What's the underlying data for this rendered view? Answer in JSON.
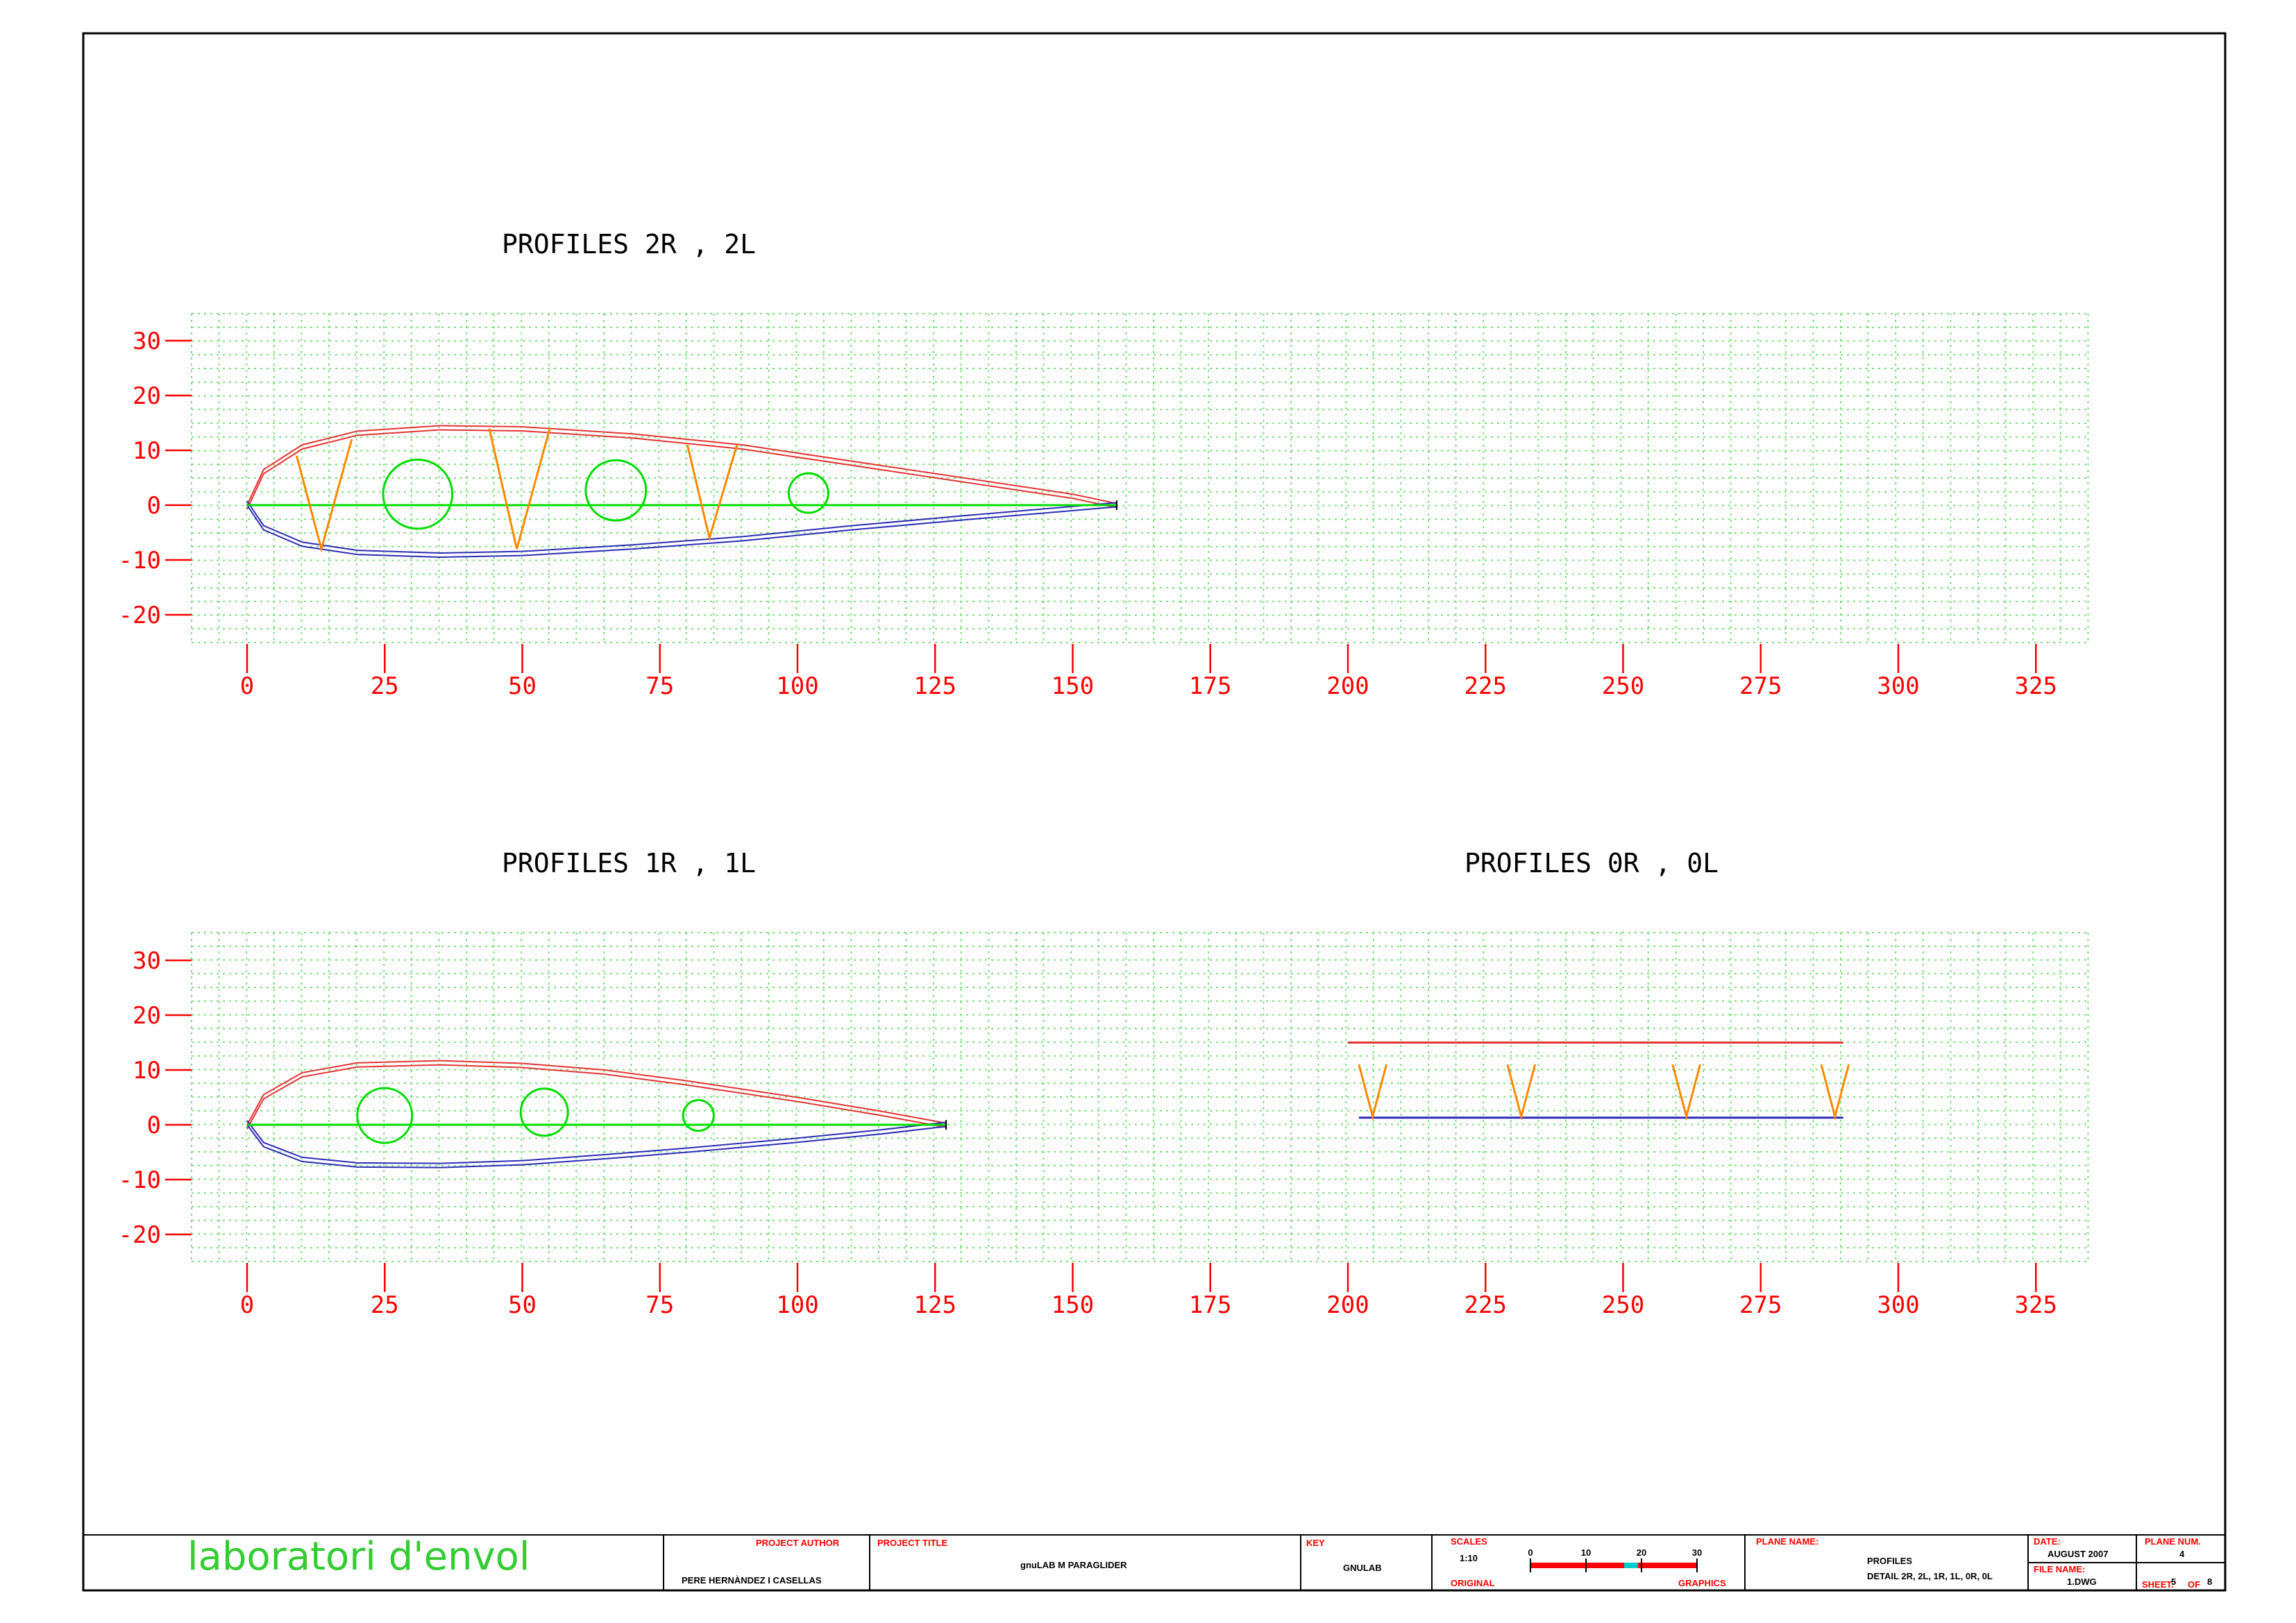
{
  "drawing": {
    "panels": [
      {
        "id": "p2",
        "title": "PROFILES 2R , 2L",
        "xticks": [
          "0",
          "25",
          "50",
          "75",
          "100",
          "125",
          "150",
          "175",
          "200",
          "225",
          "250",
          "275",
          "300",
          "325"
        ],
        "yticks": [
          "30",
          "20",
          "10",
          "0",
          "-10",
          "-20"
        ],
        "chord": 158,
        "upper": [
          [
            0,
            0
          ],
          [
            3,
            6.5
          ],
          [
            10,
            11
          ],
          [
            20,
            13.5
          ],
          [
            35,
            14.5
          ],
          [
            50,
            14.3
          ],
          [
            70,
            13
          ],
          [
            90,
            11
          ],
          [
            110,
            8
          ],
          [
            130,
            5
          ],
          [
            150,
            2
          ],
          [
            158,
            0.3
          ]
        ],
        "lower": [
          [
            0,
            0
          ],
          [
            3,
            -4.5
          ],
          [
            10,
            -7.5
          ],
          [
            20,
            -9
          ],
          [
            35,
            -9.5
          ],
          [
            50,
            -9.2
          ],
          [
            70,
            -8
          ],
          [
            90,
            -6.5
          ],
          [
            110,
            -4.5
          ],
          [
            130,
            -2.7
          ],
          [
            150,
            -1
          ],
          [
            158,
            -0.3
          ]
        ],
        "ribs": [
          [
            [
              9,
              9
            ],
            [
              13.5,
              -8
            ],
            [
              19,
              12
            ]
          ],
          [
            [
              44,
              14
            ],
            [
              49,
              -8
            ],
            [
              55,
              14
            ]
          ],
          [
            [
              80,
              11
            ],
            [
              84,
              -6
            ],
            [
              89,
              11
            ]
          ]
        ],
        "holes": [
          [
            31,
            2,
            6.3
          ],
          [
            67,
            2.7,
            5.5
          ],
          [
            102,
            2.2,
            3.6
          ]
        ]
      },
      {
        "id": "p1",
        "title": "PROFILES 1R , 1L",
        "xticks": [
          "0",
          "25",
          "50",
          "75",
          "100",
          "125",
          "150",
          "175",
          "200",
          "225",
          "250",
          "275",
          "300",
          "325"
        ],
        "yticks": [
          "30",
          "20",
          "10",
          "0",
          "-10",
          "-20"
        ],
        "chord": 127,
        "upper": [
          [
            0,
            0
          ],
          [
            3,
            5.5
          ],
          [
            10,
            9.5
          ],
          [
            20,
            11.3
          ],
          [
            35,
            11.7
          ],
          [
            50,
            11.2
          ],
          [
            65,
            10
          ],
          [
            80,
            8
          ],
          [
            100,
            5
          ],
          [
            115,
            2.5
          ],
          [
            127,
            0.3
          ]
        ],
        "lower": [
          [
            0,
            0
          ],
          [
            3,
            -4
          ],
          [
            10,
            -6.7
          ],
          [
            20,
            -7.7
          ],
          [
            35,
            -7.8
          ],
          [
            50,
            -7.3
          ],
          [
            65,
            -6.2
          ],
          [
            80,
            -5
          ],
          [
            100,
            -3.2
          ],
          [
            115,
            -1.7
          ],
          [
            127,
            -0.3
          ]
        ],
        "ribs": [],
        "holes": [
          [
            25,
            1.7,
            5
          ],
          [
            54,
            2.3,
            4.3
          ],
          [
            82,
            1.7,
            2.8
          ]
        ]
      }
    ],
    "panel3": {
      "title": "PROFILES 0R , 0L",
      "top_line": [
        200,
        290,
        15
      ],
      "bottom_line": [
        202,
        290,
        1.3
      ],
      "ribs": [
        [
          [
            202,
            11
          ],
          [
            204.5,
            1.5
          ],
          [
            207,
            11
          ]
        ],
        [
          [
            229,
            11
          ],
          [
            231.5,
            1.5
          ],
          [
            234,
            11
          ]
        ],
        [
          [
            259,
            11
          ],
          [
            261.5,
            1.5
          ],
          [
            264,
            11
          ]
        ],
        [
          [
            286,
            11
          ],
          [
            288.5,
            1.5
          ],
          [
            291,
            11
          ]
        ]
      ]
    },
    "colors": {
      "frame": "#000000",
      "grid": "#7be07b",
      "axis_label": "#ff0000",
      "upper_surface": "#e53333",
      "lower_surface": "#2b2bb8",
      "chord": "#00dd00",
      "rib": "#ff8800",
      "hole": "#00dd00",
      "title": "#000000",
      "brand": "#33cc33",
      "field_label": "#ff0000"
    }
  },
  "title_block": {
    "brand": "laboratori d'envol",
    "project_author_label": "PROJECT AUTHOR",
    "project_author": "PERE HERNÀNDEZ I CASELLAS",
    "project_title_label": "PROJECT TITLE",
    "project_title": "gnuLAB M PARAGLIDER",
    "key_label": "KEY",
    "key": "GNULAB",
    "scales_label": "SCALES",
    "scale": "1:10",
    "scale_ticks": [
      "0",
      "10",
      "20",
      "30"
    ],
    "original_label": "ORIGINAL",
    "graphics_label": "GRAPHICS",
    "plane_name_label": "PLANE NAME:",
    "plane_name": "PROFILES",
    "plane_detail": "DETAIL 2R, 2L, 1R, 1L, 0R, 0L",
    "date_label": "DATE:",
    "date": "AUGUST 2007",
    "plane_num_label": "PLANE NUM.",
    "plane_num": "4",
    "file_name_label": "FILE NAME:",
    "file_name": "1.DWG",
    "sheet_label": "SHEET:",
    "sheet_num": "5",
    "sheet_of": "OF",
    "sheet_total": "8"
  }
}
